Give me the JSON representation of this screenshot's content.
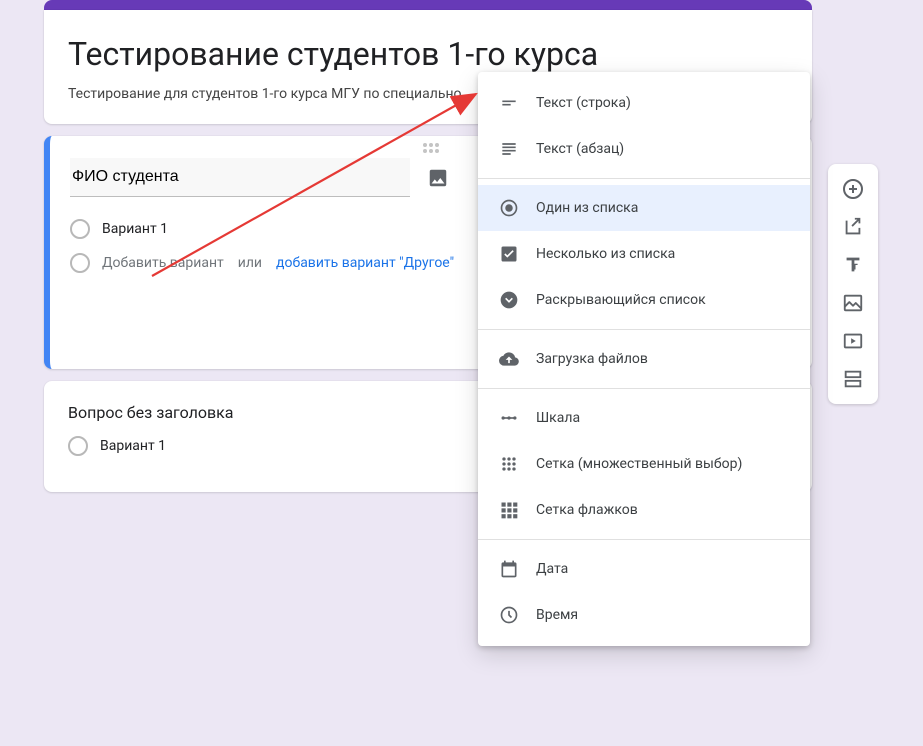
{
  "form": {
    "title": "Тестирование студентов 1-го курса",
    "description": "Тестирование для студентов 1-го курса МГУ по специально"
  },
  "active_question": {
    "title_placeholder": "ФИО студента",
    "option1": "Вариант 1",
    "add_option": "Добавить вариант",
    "or": "или",
    "add_other": "добавить вариант \"Другое\""
  },
  "question2": {
    "title": "Вопрос без заголовка",
    "option1": "Вариант 1"
  },
  "menu": {
    "short_text": "Текст (строка)",
    "paragraph": "Текст (абзац)",
    "radio": "Один из списка",
    "checkbox": "Несколько из списка",
    "dropdown": "Раскрывающийся список",
    "upload": "Загрузка файлов",
    "scale": "Шкала",
    "grid_radio": "Сетка (множественный выбор)",
    "grid_check": "Сетка флажков",
    "date": "Дата",
    "time": "Время",
    "selected": "radio"
  },
  "toolbar": {
    "add_question": "add",
    "import": "import",
    "add_title": "title",
    "add_image": "image",
    "add_video": "video",
    "add_section": "section"
  }
}
